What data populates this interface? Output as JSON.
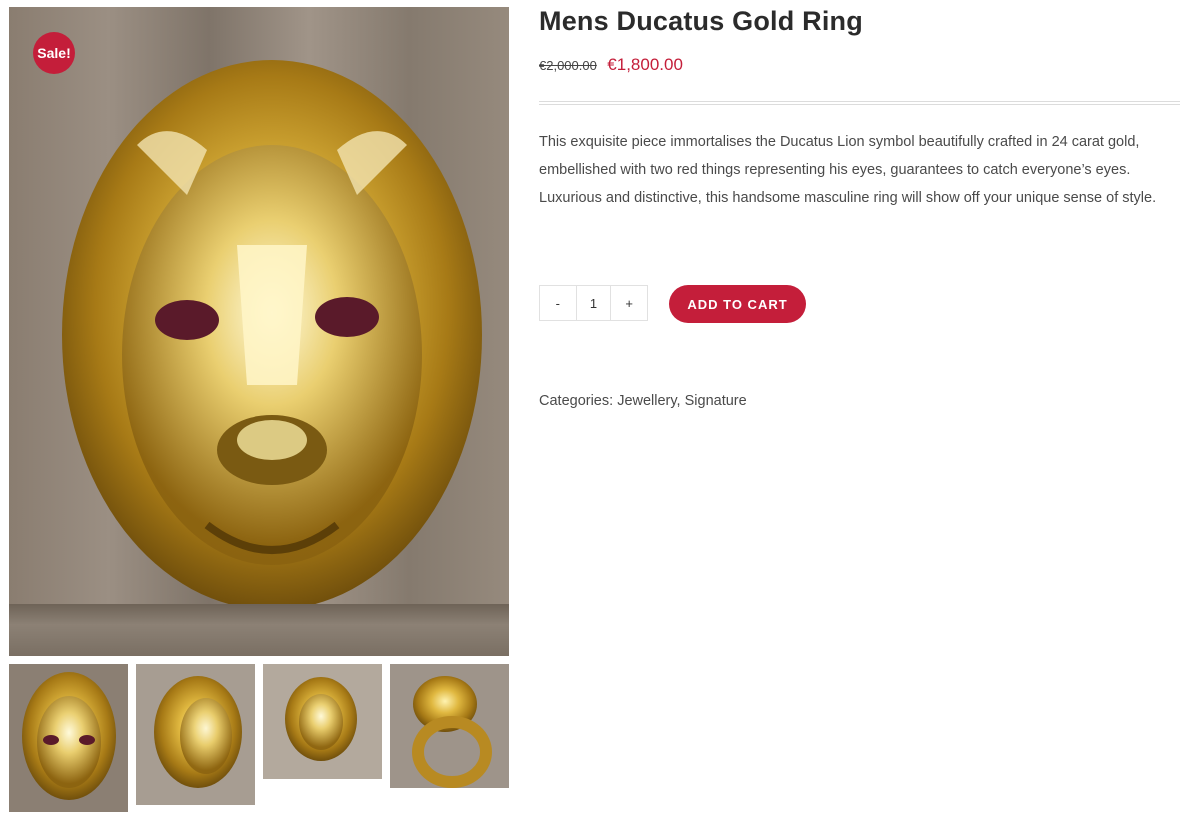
{
  "product": {
    "title": "Mens Ducatus Gold Ring",
    "sale_badge": "Sale!",
    "old_price": "€2,000.00",
    "new_price": "€1,800.00",
    "description": "This exquisite piece immortalises the Ducatus Lion symbol beautifully crafted in 24 carat gold, embellished with two red things representing his eyes, guarantees to catch everyone’s eyes. Luxurious and distinctive, this handsome masculine ring will show off your unique sense of style.",
    "quantity": "1",
    "decrement_label": "-",
    "increment_label": "+",
    "add_to_cart_label": "ADD TO CART",
    "categories_label": "Categories:",
    "categories": [
      "Jewellery",
      "Signature"
    ],
    "category_separator": ","
  },
  "colors": {
    "accent": "#c41e3a",
    "gold": "#c9a227"
  },
  "gallery": {
    "main_image": "lion-head-gold-ring-front",
    "thumbnails": [
      "lion-ring-front",
      "lion-ring-angle-left",
      "lion-ring-side",
      "lion-ring-band"
    ]
  }
}
